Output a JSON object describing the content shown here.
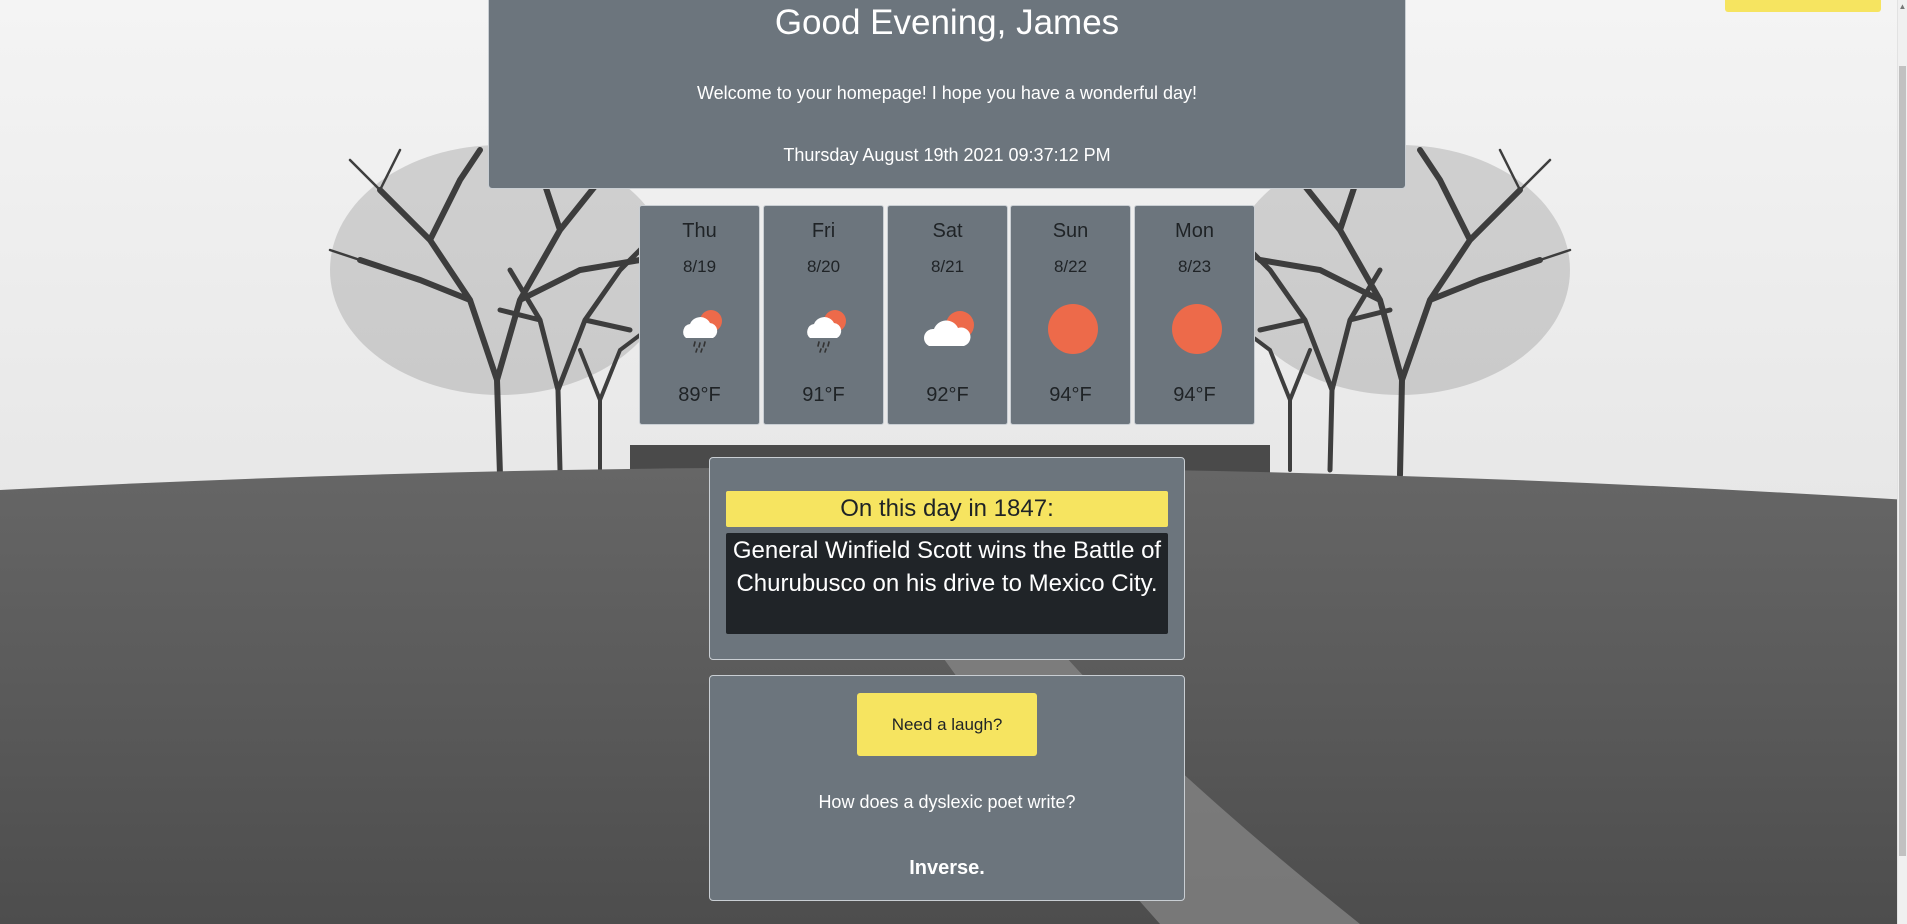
{
  "greeting": {
    "title": "Good Evening, James",
    "welcome": "Welcome to your homepage! I hope you have a wonderful day!",
    "datetime": "Thursday August 19th 2021 09:37:12 PM"
  },
  "forecast": [
    {
      "day": "Thu",
      "date": "8/19",
      "temp": "89°F",
      "icon": "cloud-sun-rain-icon"
    },
    {
      "day": "Fri",
      "date": "8/20",
      "temp": "91°F",
      "icon": "cloud-sun-rain-icon"
    },
    {
      "day": "Sat",
      "date": "8/21",
      "temp": "92°F",
      "icon": "cloud-sun-icon"
    },
    {
      "day": "Sun",
      "date": "8/22",
      "temp": "94°F",
      "icon": "sun-icon"
    },
    {
      "day": "Mon",
      "date": "8/23",
      "temp": "94°F",
      "icon": "sun-icon"
    }
  ],
  "history": {
    "heading": "On this day in 1847:",
    "event": "General Winfield Scott wins the Battle of Churubusco on his drive to Mexico City."
  },
  "joke": {
    "button_label": "Need a laugh?",
    "question": "How does a dyslexic poet write?",
    "answer": "Inverse."
  },
  "colors": {
    "panel": "#6c757d",
    "accent_yellow": "#f6e460",
    "sun_orange": "#ed6a4a",
    "dark_box": "#202428"
  }
}
